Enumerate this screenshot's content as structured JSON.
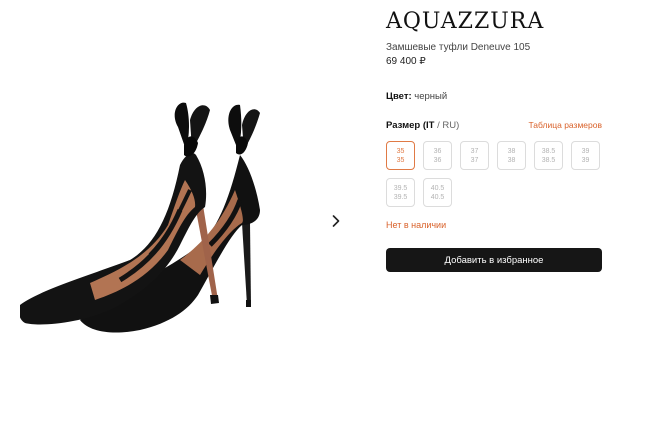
{
  "product": {
    "brand": "AQUAZZURA",
    "name": "Замшевые туфли Deneuve 105",
    "price": "69 400 ₽",
    "image_description": "black-suede-pumps-with-bow"
  },
  "color": {
    "label": "Цвет",
    "separator": ":",
    "value": " черный"
  },
  "size": {
    "title_bold": "Размер (IT",
    "title_rest": " / RU)",
    "guide_link": "Таблица размеров",
    "options": [
      {
        "it": "35",
        "ru": "35",
        "selected": true
      },
      {
        "it": "36",
        "ru": "36",
        "selected": false
      },
      {
        "it": "37",
        "ru": "37",
        "selected": false
      },
      {
        "it": "38",
        "ru": "38",
        "selected": false
      },
      {
        "it": "38.5",
        "ru": "38.5",
        "selected": false
      },
      {
        "it": "39",
        "ru": "39",
        "selected": false
      },
      {
        "it": "39.5",
        "ru": "39.5",
        "selected": false
      },
      {
        "it": "40.5",
        "ru": "40.5",
        "selected": false
      }
    ]
  },
  "stock_status": "Нет в наличии",
  "actions": {
    "favorite_label": "Добавить в избранное"
  },
  "icons": {
    "next": "chevron-right-icon"
  },
  "colors": {
    "accent": "#d9622b",
    "button_bg": "#161616",
    "border": "#dcdcdc"
  }
}
